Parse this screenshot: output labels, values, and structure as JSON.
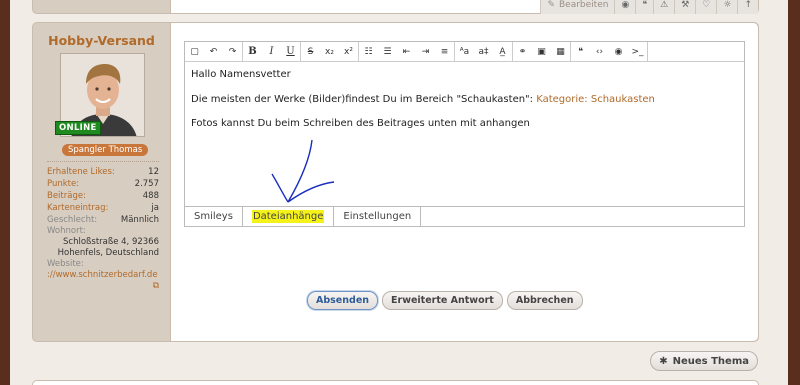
{
  "prev_post": {
    "actions": [
      {
        "icon": "pencil-icon",
        "label": "Bearbeiten"
      },
      {
        "icon": "globe-icon",
        "label": ""
      },
      {
        "icon": "quote-icon",
        "label": ""
      },
      {
        "icon": "warning-icon",
        "label": ""
      },
      {
        "icon": "hammer-icon",
        "label": ""
      },
      {
        "icon": "thumbs-up-icon",
        "label": ""
      },
      {
        "icon": "lightbulb-icon",
        "label": ""
      },
      {
        "icon": "arrow-up-icon",
        "label": ""
      }
    ]
  },
  "user": {
    "name": "Hobby-Versand",
    "online": "ONLINE",
    "real_name": "Spangler Thomas",
    "stats": [
      {
        "key": "Erhaltene Likes:",
        "value": "12"
      },
      {
        "key": "Punkte:",
        "value": "2.757"
      },
      {
        "key": "Beiträge:",
        "value": "488"
      },
      {
        "key": "Karteneintrag:",
        "value": "ja"
      },
      {
        "key": "Geschlecht:",
        "value": "Männlich"
      }
    ],
    "wohnort_label": "Wohnort:",
    "wohnort_value": "Schloßstraße 4, 92366 Hohenfels, Deutschland",
    "website_label": "Website:",
    "website_value": "://www.schnitzerbedarf.de"
  },
  "editor": {
    "line1": "Hallo Namensvetter",
    "line2_text": "Die meisten der Werke (Bilder)findest Du im Bereich \"Schaukasten\": ",
    "line2_link": "Kategorie: Schaukasten",
    "line3": "Fotos kannst Du beim Schreiben des Beitrages unten mit anhangen"
  },
  "tabs": {
    "smileys": "Smileys",
    "attachments": "Dateianhänge",
    "settings": "Einstellungen"
  },
  "buttons": {
    "submit": "Absenden",
    "extended": "Erweiterte Antwort",
    "cancel": "Abbrechen",
    "new_thread": "Neues Thema"
  },
  "colors": {
    "accent": "#b06a2a",
    "online": "#1f8a1f",
    "highlight": "#f5f21a",
    "annotation": "#1a2fbf"
  }
}
